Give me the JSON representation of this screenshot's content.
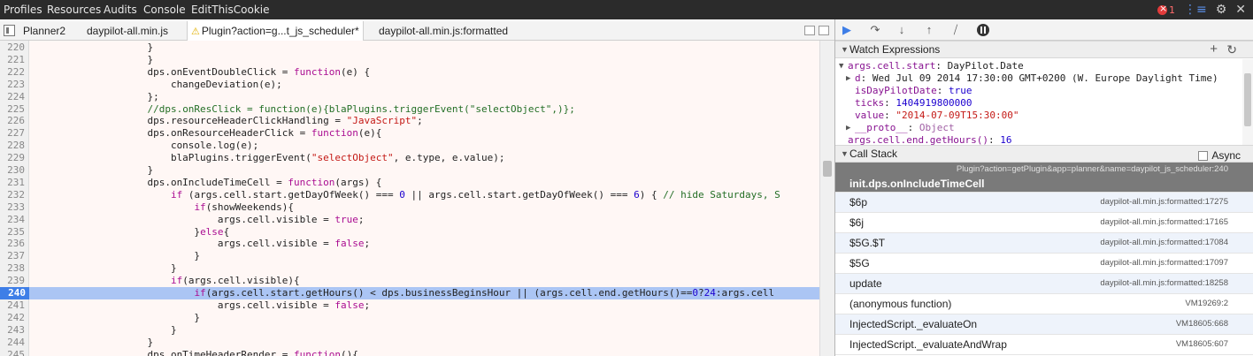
{
  "menu": {
    "items": [
      "Profiles",
      "Resources",
      "Audits",
      "Console",
      "EditThisCookie"
    ],
    "error_count": "1"
  },
  "tabs": [
    "Planner2",
    "daypilot-all.min.js",
    "Plugin?action=g...t_js_scheduler*",
    "daypilot-all.min.js:formatted"
  ],
  "editor": {
    "current_line": 240,
    "lines": [
      {
        "n": "220",
        "t": "                    }"
      },
      {
        "n": "221",
        "t": "                    }"
      },
      {
        "n": "222",
        "t": "                    dps.onEventDoubleClick = function(e) {"
      },
      {
        "n": "223",
        "t": "                        changeDeviation(e);"
      },
      {
        "n": "224",
        "t": "                    };"
      },
      {
        "n": "225",
        "t": "                    //dps.onResClick = function(e){blaPlugins.triggerEvent(\"selectObject\",)};"
      },
      {
        "n": "226",
        "t": "                    dps.resourceHeaderClickHandling = \"JavaScript\";"
      },
      {
        "n": "227",
        "t": "                    dps.onResourceHeaderClick = function(e){"
      },
      {
        "n": "228",
        "t": "                        console.log(e);"
      },
      {
        "n": "229",
        "t": "                        blaPlugins.triggerEvent(\"selectObject\", e.type, e.value);"
      },
      {
        "n": "230",
        "t": "                    }"
      },
      {
        "n": "231",
        "t": "                    dps.onIncludeTimeCell = function(args) {"
      },
      {
        "n": "232",
        "t": "                        if (args.cell.start.getDayOfWeek() === 0 || args.cell.start.getDayOfWeek() === 6) { // hide Saturdays, S"
      },
      {
        "n": "233",
        "t": "                            if(showWeekends){"
      },
      {
        "n": "234",
        "t": "                                args.cell.visible = true;"
      },
      {
        "n": "235",
        "t": "                            }else{"
      },
      {
        "n": "236",
        "t": "                                args.cell.visible = false;"
      },
      {
        "n": "237",
        "t": "                            }"
      },
      {
        "n": "238",
        "t": "                        }"
      },
      {
        "n": "239",
        "t": "                        if(args.cell.visible){"
      },
      {
        "n": "240",
        "t": "                            if(args.cell.start.getHours() < dps.businessBeginsHour || (args.cell.end.getHours()==0?24:args.cell"
      },
      {
        "n": "241",
        "t": "                                args.cell.visible = false;"
      },
      {
        "n": "242",
        "t": "                            }"
      },
      {
        "n": "243",
        "t": "                        }"
      },
      {
        "n": "244",
        "t": "                    }"
      },
      {
        "n": "245",
        "t": "                    dps.onTimeHeaderRender = function(){"
      }
    ]
  },
  "watch": {
    "header": "Watch Expressions",
    "lines": [
      {
        "kind": "expanded",
        "name": "args.cell.start",
        "sep": ": ",
        "value": "DayPilot.Date",
        "vclass": ""
      },
      {
        "kind": "collapsed",
        "name": "d",
        "sep": ": ",
        "value": "Wed Jul 09 2014 17:30:00 GMT+0200 (W. Europe Daylight Time)",
        "vclass": ""
      },
      {
        "kind": "leaf",
        "name": "isDayPilotDate",
        "sep": ": ",
        "value": "true",
        "vclass": "wval-num"
      },
      {
        "kind": "leaf",
        "name": "ticks",
        "sep": ": ",
        "value": "1404919800000",
        "vclass": "wval-num"
      },
      {
        "kind": "leaf",
        "name": "value",
        "sep": ": ",
        "value": "\"2014-07-09T15:30:00\"",
        "vclass": "wval-str"
      },
      {
        "kind": "collapsed",
        "name": "__proto__",
        "sep": ": ",
        "value": "Object",
        "vclass": "wval-dim"
      },
      {
        "kind": "root",
        "name": "args.cell.end.getHours()",
        "sep": ": ",
        "value": "16",
        "vclass": "wval-num"
      }
    ]
  },
  "callstack": {
    "header": "Call Stack",
    "async_label": "Async",
    "frames": [
      {
        "fn": "init.dps.onIncludeTimeCell",
        "loc": "Plugin?action=getPlugin&app=planner&name=daypilot_js_scheduler:240"
      },
      {
        "fn": "$6p",
        "loc": "daypilot-all.min.js:formatted:17275"
      },
      {
        "fn": "$6j",
        "loc": "daypilot-all.min.js:formatted:17165"
      },
      {
        "fn": "$5G.$T",
        "loc": "daypilot-all.min.js:formatted:17084"
      },
      {
        "fn": "$5G",
        "loc": "daypilot-all.min.js:formatted:17097"
      },
      {
        "fn": "update",
        "loc": "daypilot-all.min.js:formatted:18258"
      },
      {
        "fn": "(anonymous function)",
        "loc": "VM19269:2"
      },
      {
        "fn": "InjectedScript._evaluateOn",
        "loc": "VM18605:668"
      },
      {
        "fn": "InjectedScript._evaluateAndWrap",
        "loc": "VM18605:607"
      }
    ]
  }
}
